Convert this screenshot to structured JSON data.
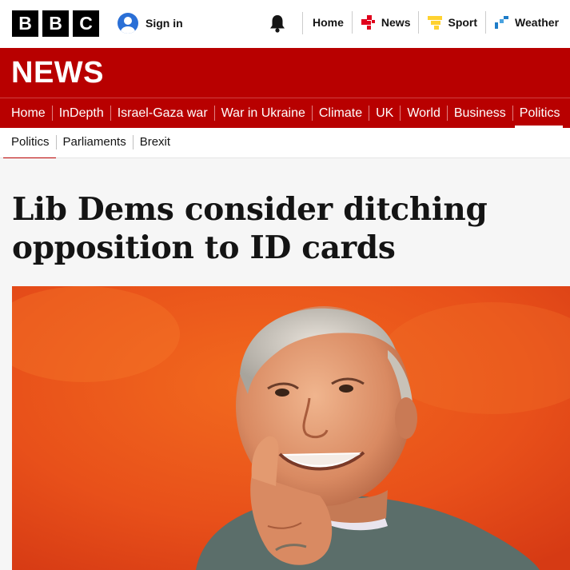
{
  "brand": {
    "logo_letters": [
      "B",
      "B",
      "C"
    ],
    "masthead": "NEWS",
    "accent_color": "#b80000"
  },
  "top_bar": {
    "signin_label": "Sign in",
    "nav": [
      {
        "label": "Home",
        "icon": ""
      },
      {
        "label": "News",
        "icon": "news-icon"
      },
      {
        "label": "Sport",
        "icon": "sport-icon"
      },
      {
        "label": "Weather",
        "icon": "weather-icon"
      }
    ]
  },
  "section_nav": {
    "items": [
      "Home",
      "InDepth",
      "Israel-Gaza war",
      "War in Ukraine",
      "Climate",
      "UK",
      "World",
      "Business",
      "Politics"
    ],
    "active": "Politics"
  },
  "sub_nav": {
    "items": [
      "Politics",
      "Parliaments",
      "Brexit"
    ],
    "active": "Politics"
  },
  "article": {
    "headline_line1": "Lib Dems consider ditching",
    "headline_line2": "opposition to ID cards"
  }
}
